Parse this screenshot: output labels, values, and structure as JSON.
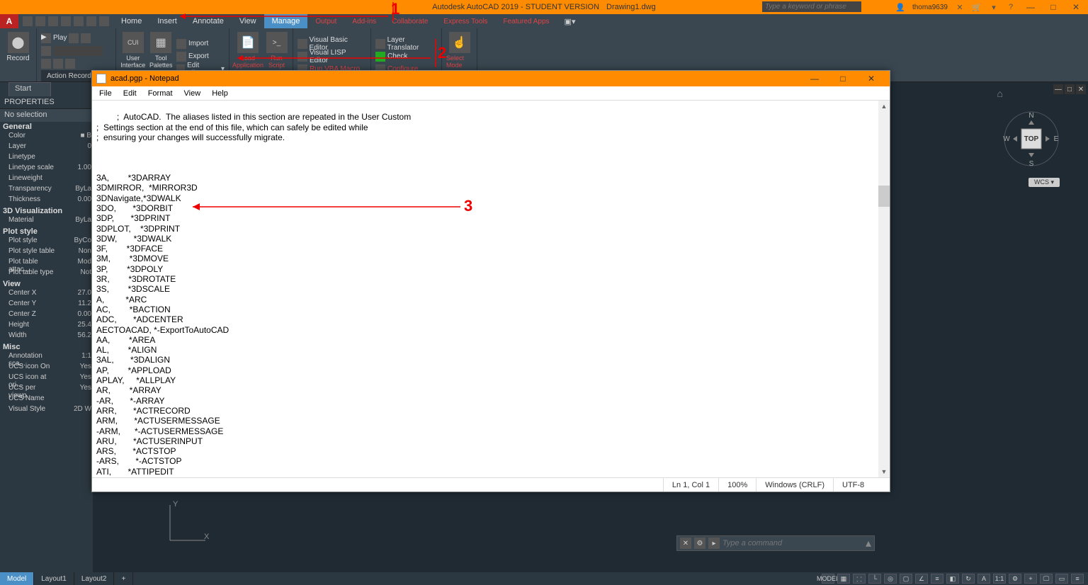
{
  "title": {
    "app": "Autodesk AutoCAD 2019 - STUDENT VERSION",
    "doc": "Drawing1.dwg",
    "search_ph": "Type a keyword or phrase",
    "user": "thoma9639"
  },
  "menu": {
    "tabs": [
      "Home",
      "Insert",
      "Annotate",
      "View",
      "Manage",
      "Output",
      "Add-ins",
      "Collaborate",
      "Express Tools",
      "Featured Apps"
    ],
    "active": 4
  },
  "ribbon": {
    "record": "Record",
    "play": "Play",
    "action_recorder": "Action Recorder",
    "cui": "User Interface",
    "tool_palettes": "Tool Palettes",
    "import": "Import",
    "export": "Export",
    "edit_aliases": "Edit Aliases",
    "load_app": "Load Application",
    "run_script": "Run Script",
    "vbe": "Visual Basic Editor",
    "vle": "Visual LISP Editor",
    "vba": "Run VBA Macro",
    "layer_trans": "Layer Translator",
    "check": "Check",
    "configure": "Configure",
    "select_mode": "Select Mode"
  },
  "start": "Start",
  "props": {
    "header": "PROPERTIES",
    "sel": "No selection",
    "groups": [
      {
        "name": "General",
        "rows": [
          [
            "Color",
            "■ B"
          ],
          [
            "Layer",
            "0"
          ],
          [
            "Linetype",
            ""
          ],
          [
            "Linetype scale",
            "1.00"
          ],
          [
            "Lineweight",
            ""
          ],
          [
            "Transparency",
            "ByLa"
          ],
          [
            "Thickness",
            "0.00"
          ]
        ]
      },
      {
        "name": "3D Visualization",
        "rows": [
          [
            "Material",
            "ByLa"
          ]
        ]
      },
      {
        "name": "Plot style",
        "rows": [
          [
            "Plot style",
            "ByCo"
          ],
          [
            "Plot style table",
            "Non"
          ],
          [
            "Plot table attac...",
            "Mod"
          ],
          [
            "Plot table type",
            "Not"
          ]
        ]
      },
      {
        "name": "View",
        "rows": [
          [
            "Center X",
            "27.0"
          ],
          [
            "Center Y",
            "11.2"
          ],
          [
            "Center Z",
            "0.00"
          ],
          [
            "Height",
            "25.4"
          ],
          [
            "Width",
            "56.2"
          ]
        ]
      },
      {
        "name": "Misc",
        "rows": [
          [
            "Annotation sca...",
            "1:1"
          ],
          [
            "UCS icon On",
            "Yes"
          ],
          [
            "UCS icon at ori...",
            "Yes"
          ],
          [
            "UCS per viewp...",
            "Yes"
          ],
          [
            "UCS Name",
            ""
          ],
          [
            "Visual Style",
            "2D W"
          ]
        ]
      }
    ]
  },
  "viewcube": {
    "top": "TOP",
    "n": "N",
    "s": "S",
    "e": "E",
    "w": "W",
    "wcs": "WCS"
  },
  "cmd": {
    "ph": "Type a command"
  },
  "btabs": {
    "items": [
      "Model",
      "Layout1",
      "Layout2"
    ],
    "model": "MODEL",
    "ratio": "1:1"
  },
  "notepad": {
    "title": "acad.pgp - Notepad",
    "menu": [
      "File",
      "Edit",
      "Format",
      "View",
      "Help"
    ],
    "content": ";  AutoCAD.  The aliases listed in this section are repeated in the User Custom\n;  Settings section at the end of this file, which can safely be edited while\n;  ensuring your changes will successfully migrate.\n\n\n\n3A,        *3DARRAY\n3DMIRROR,  *MIRROR3D\n3DNavigate,*3DWALK\n3DO,       *3DORBIT\n3DP,       *3DPRINT\n3DPLOT,    *3DPRINT\n3DW,       *3DWALK\n3F,        *3DFACE\n3M,        *3DMOVE\n3P,        *3DPOLY\n3R,        *3DROTATE\n3S,        *3DSCALE\nA,         *ARC\nAC,        *BACTION\nADC,       *ADCENTER\nAECTOACAD, *-ExportToAutoCAD\nAA,        *AREA\nAL,        *ALIGN\n3AL,       *3DALIGN\nAP,        *APPLOAD\nAPLAY,     *ALLPLAY\nAR,        *ARRAY\n-AR,       *-ARRAY\nARR,       *ACTRECORD\nARM,       *ACTUSERMESSAGE\n-ARM,      *-ACTUSERMESSAGE\nARU,       *ACTUSERINPUT\nARS,       *ACTSTOP\n-ARS,       *-ACTSTOP\nATI,       *ATTIPEDIT\nATT,       *ATTDEF\n-ATT       *-ATTDEF",
    "status": {
      "pos": "Ln 1, Col 1",
      "zoom": "100%",
      "enc": "Windows (CRLF)",
      "cs": "UTF-8"
    }
  },
  "annot": {
    "n1": "1",
    "n2": "2",
    "n3": "3"
  },
  "axis": {
    "x": "X",
    "y": "Y"
  }
}
